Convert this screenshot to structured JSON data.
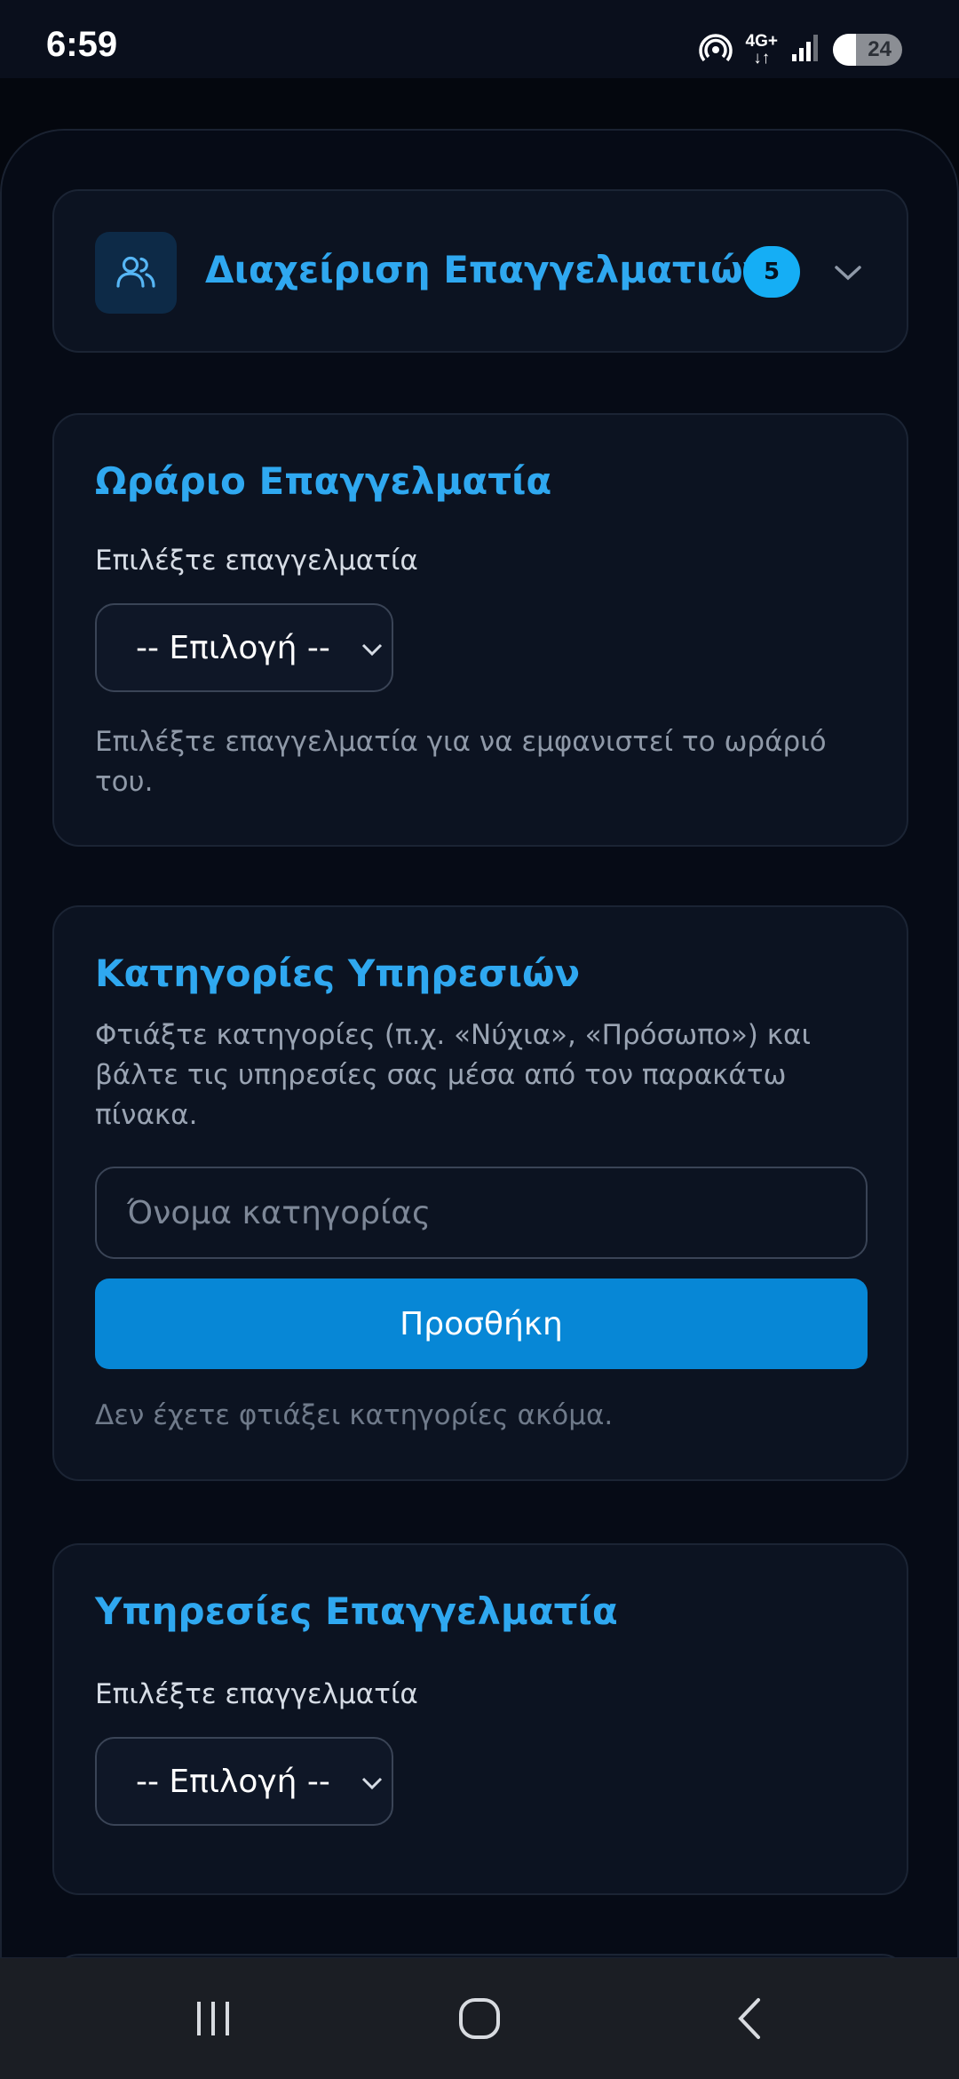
{
  "status_bar": {
    "time": "6:59",
    "network": "4G+",
    "battery": "24"
  },
  "header": {
    "title": "Διαχείριση Επαγγελματιών",
    "count": "5",
    "icon": "users-icon"
  },
  "schedule": {
    "title": "Ωράριο Επαγγελματία",
    "select_label": "Επιλέξτε επαγγελματία",
    "select_value": "-- Επιλογή --",
    "helper": "Επιλέξτε επαγγελματία για να εμφανιστεί το ωράριό του."
  },
  "categories": {
    "title": "Κατηγορίες Υπηρεσιών",
    "description": "Φτιάξτε κατηγορίες (π.χ. «Νύχια», «Πρόσωπο») και βάλτε τις υπηρεσίες σας μέσα από τον παρακάτω πίνακα.",
    "input_placeholder": "Όνομα κατηγορίας",
    "add_button": "Προσθήκη",
    "empty_text": "Δεν έχετε φτιάξει κατηγορίες ακόμα."
  },
  "services": {
    "title": "Υπηρεσίες Επαγγελματία",
    "select_label": "Επιλέξτε επαγγελματία",
    "select_value": "-- Επιλογή --"
  },
  "colors": {
    "accent": "#2fa8f0",
    "button": "#0787d6",
    "badge": "#15aef5",
    "background": "#060b16",
    "card": "#0c1321"
  }
}
